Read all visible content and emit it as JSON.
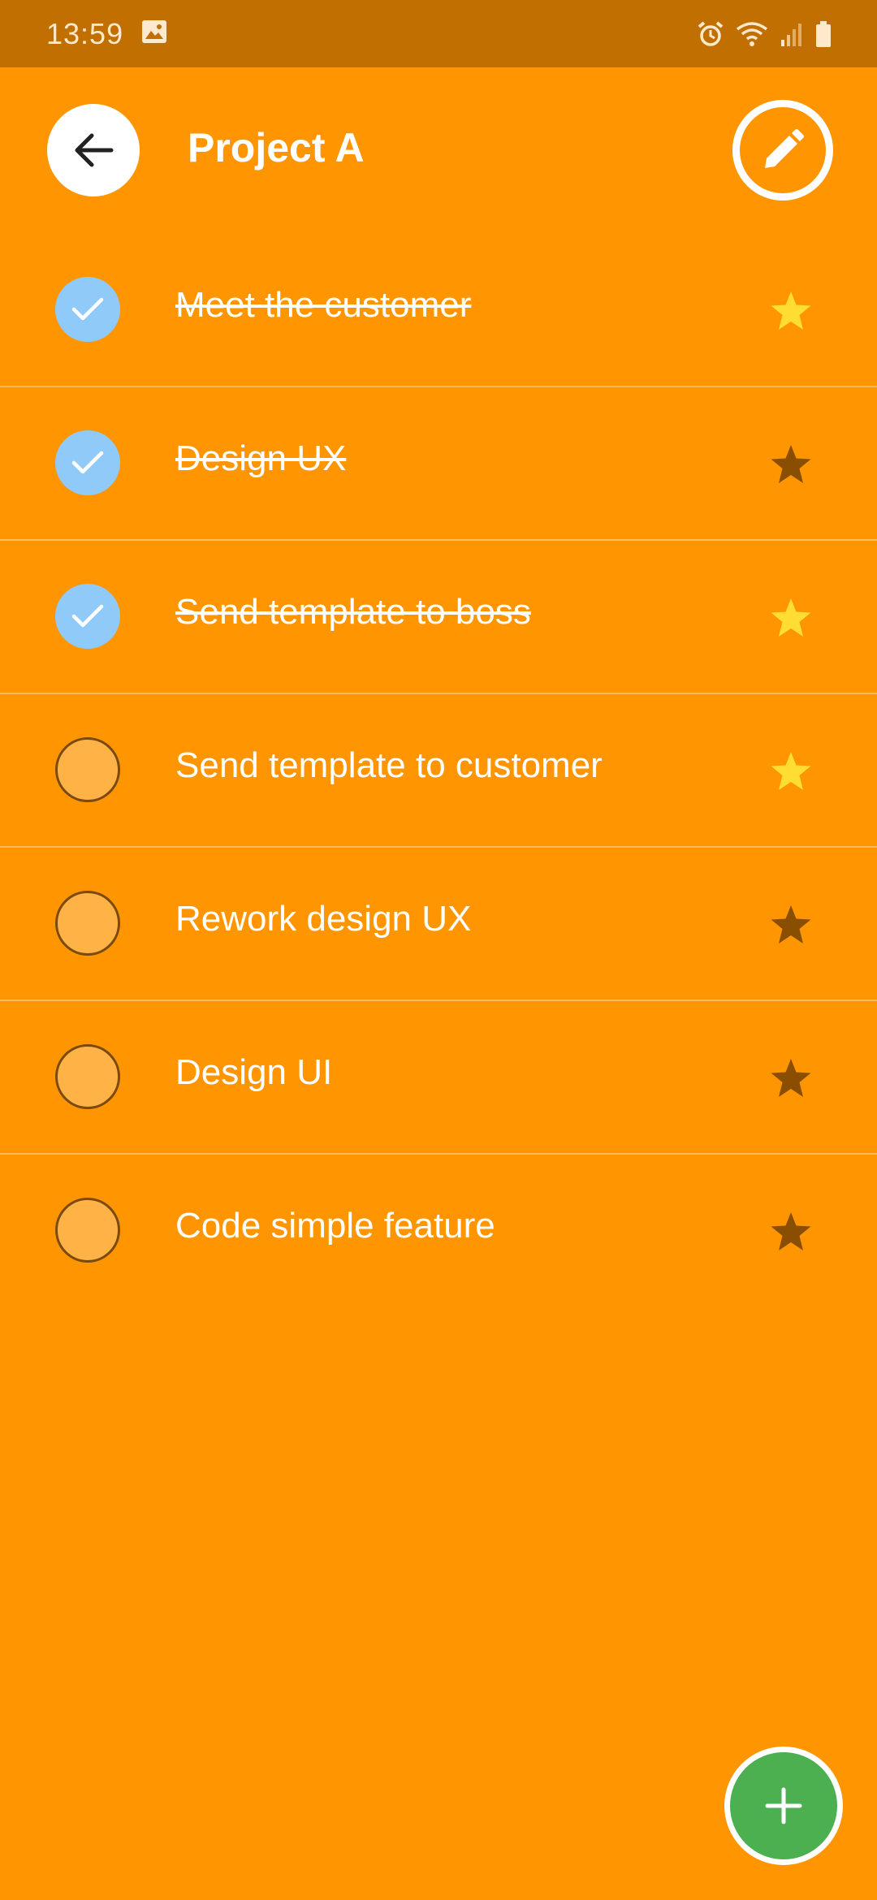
{
  "status_bar": {
    "time": "13:59",
    "icons": [
      "image-icon",
      "alarm-icon",
      "wifi-icon",
      "signal-icon",
      "battery-icon"
    ]
  },
  "header": {
    "title": "Project A",
    "back_icon": "arrow-left-icon",
    "edit_icon": "pencil-icon"
  },
  "tasks": [
    {
      "label": "Meet the customer",
      "done": true,
      "starred": true
    },
    {
      "label": "Design UX",
      "done": true,
      "starred": false
    },
    {
      "label": "Send template to boss",
      "done": true,
      "starred": true
    },
    {
      "label": "Send template to customer",
      "done": false,
      "starred": true
    },
    {
      "label": "Rework design UX",
      "done": false,
      "starred": false
    },
    {
      "label": "Design UI",
      "done": false,
      "starred": false
    },
    {
      "label": "Code simple feature",
      "done": false,
      "starred": false
    }
  ],
  "fab": {
    "icon": "plus-icon"
  },
  "colors": {
    "background": "#FF9500",
    "status_bar": "#C06F00",
    "check_done": "#90CAF9",
    "check_todo": "#FFB347",
    "star_on": "#FFDD33",
    "star_off": "#8A4E00",
    "fab": "#4CAF50"
  }
}
